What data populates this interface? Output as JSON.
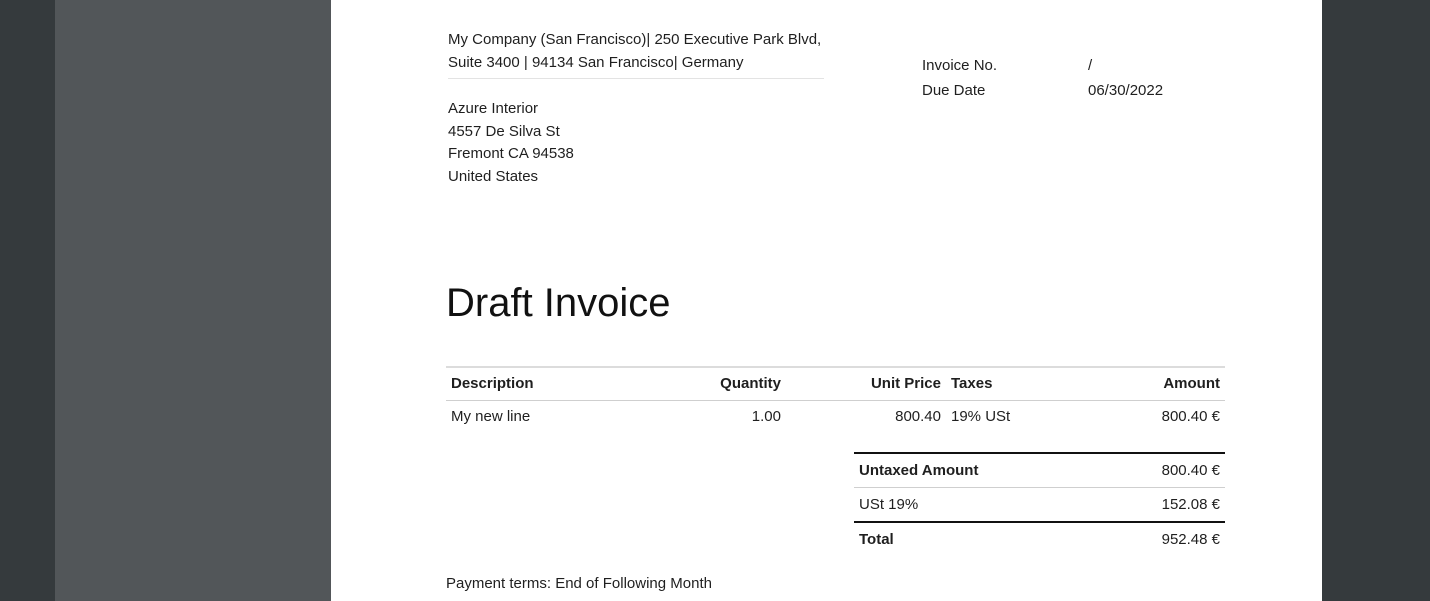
{
  "sender": {
    "line1": "My Company (San Francisco)| 250 Executive Park Blvd,",
    "line2": "Suite 3400 | 94134 San Francisco| Germany"
  },
  "invoice_meta": {
    "number_label": "Invoice No.",
    "number_value": "/",
    "due_label": "Due Date",
    "due_value": "06/30/2022"
  },
  "recipient": {
    "name": "Azure Interior",
    "street": "4557 De Silva St",
    "city": "Fremont CA 94538",
    "country": "United States"
  },
  "title": "Draft Invoice",
  "lines_table": {
    "headers": {
      "description": "Description",
      "quantity": "Quantity",
      "unit_price": "Unit Price",
      "taxes": "Taxes",
      "amount": "Amount"
    },
    "rows": [
      {
        "description": "My new line",
        "quantity": "1.00",
        "unit_price": "800.40",
        "taxes": "19% USt",
        "amount": "800.40 €"
      }
    ]
  },
  "totals": {
    "untaxed_label": "Untaxed Amount",
    "untaxed_value": "800.40 €",
    "tax_label": "USt 19%",
    "tax_value": "152.08 €",
    "total_label": "Total",
    "total_value": "952.48 €"
  },
  "payment_terms": "Payment terms: End of Following Month"
}
